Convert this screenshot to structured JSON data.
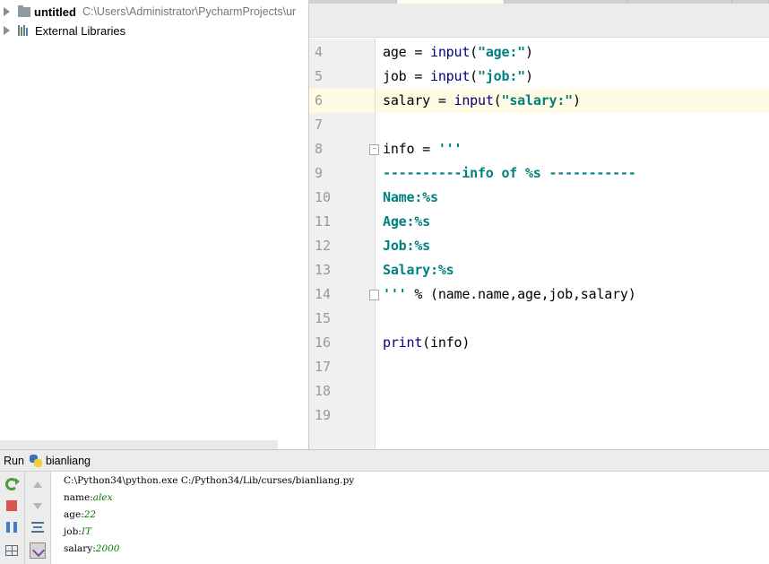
{
  "project": {
    "name": "untitled",
    "path": "C:\\Users\\Administrator\\PycharmProjects\\ur",
    "libraries": "External Libraries"
  },
  "editor": {
    "current_line": 6,
    "lines": [
      {
        "n": "4"
      },
      {
        "n": "5"
      },
      {
        "n": "6"
      },
      {
        "n": "7"
      },
      {
        "n": "8"
      },
      {
        "n": "9"
      },
      {
        "n": "10"
      },
      {
        "n": "11"
      },
      {
        "n": "12"
      },
      {
        "n": "13"
      },
      {
        "n": "14"
      },
      {
        "n": "15"
      },
      {
        "n": "16"
      },
      {
        "n": "17"
      },
      {
        "n": "18"
      },
      {
        "n": "19"
      }
    ],
    "code": {
      "l4": {
        "var": "age",
        "op": " = ",
        "fn": "input",
        "open": "(",
        "str": "\"age:\"",
        "close": ")"
      },
      "l5": {
        "var": "job",
        "op": " = ",
        "fn": "input",
        "open": "(",
        "str": "\"job:\"",
        "close": ")"
      },
      "l6": {
        "var": "salary",
        "op": " = ",
        "fn": "input",
        "open": "(",
        "str": "\"salary:\"",
        "close": ")"
      },
      "l8": {
        "var": "info",
        "op": " = ",
        "str": "'''"
      },
      "l9": {
        "str": "----------info of %s -----------"
      },
      "l10": {
        "str": "Name:%s"
      },
      "l11": {
        "str": "Age:%s"
      },
      "l12": {
        "str": "Job:%s"
      },
      "l13": {
        "str": "Salary:%s"
      },
      "l14": {
        "str": "'''",
        "rest": " % (name.name,age,job,salary)"
      },
      "l16": {
        "fn": "print",
        "open": "(",
        "arg": "info",
        "close": ")"
      }
    }
  },
  "run": {
    "label": "Run",
    "config": "bianliang",
    "console": {
      "command": "C:\\Python34\\python.exe C:/Python34/Lib/curses/bianliang.py",
      "lines": [
        {
          "prompt": "name:",
          "input": "alex"
        },
        {
          "prompt": "age:",
          "input": "22"
        },
        {
          "prompt": "job:",
          "input": "IT"
        },
        {
          "prompt": "salary:",
          "input": "2000"
        }
      ]
    }
  },
  "colors": {
    "string": "#008080",
    "builtin": "#000080",
    "current_line": "#fffae3",
    "console_input": "#007a00"
  },
  "icons": {
    "rerun": "rerun-icon",
    "stop": "stop-icon",
    "pause": "pause-icon",
    "layout": "layout-icon",
    "up": "arrow-up-icon",
    "down": "arrow-down-icon",
    "wrap": "soft-wrap-icon",
    "scroll_end": "scroll-to-end-icon"
  }
}
